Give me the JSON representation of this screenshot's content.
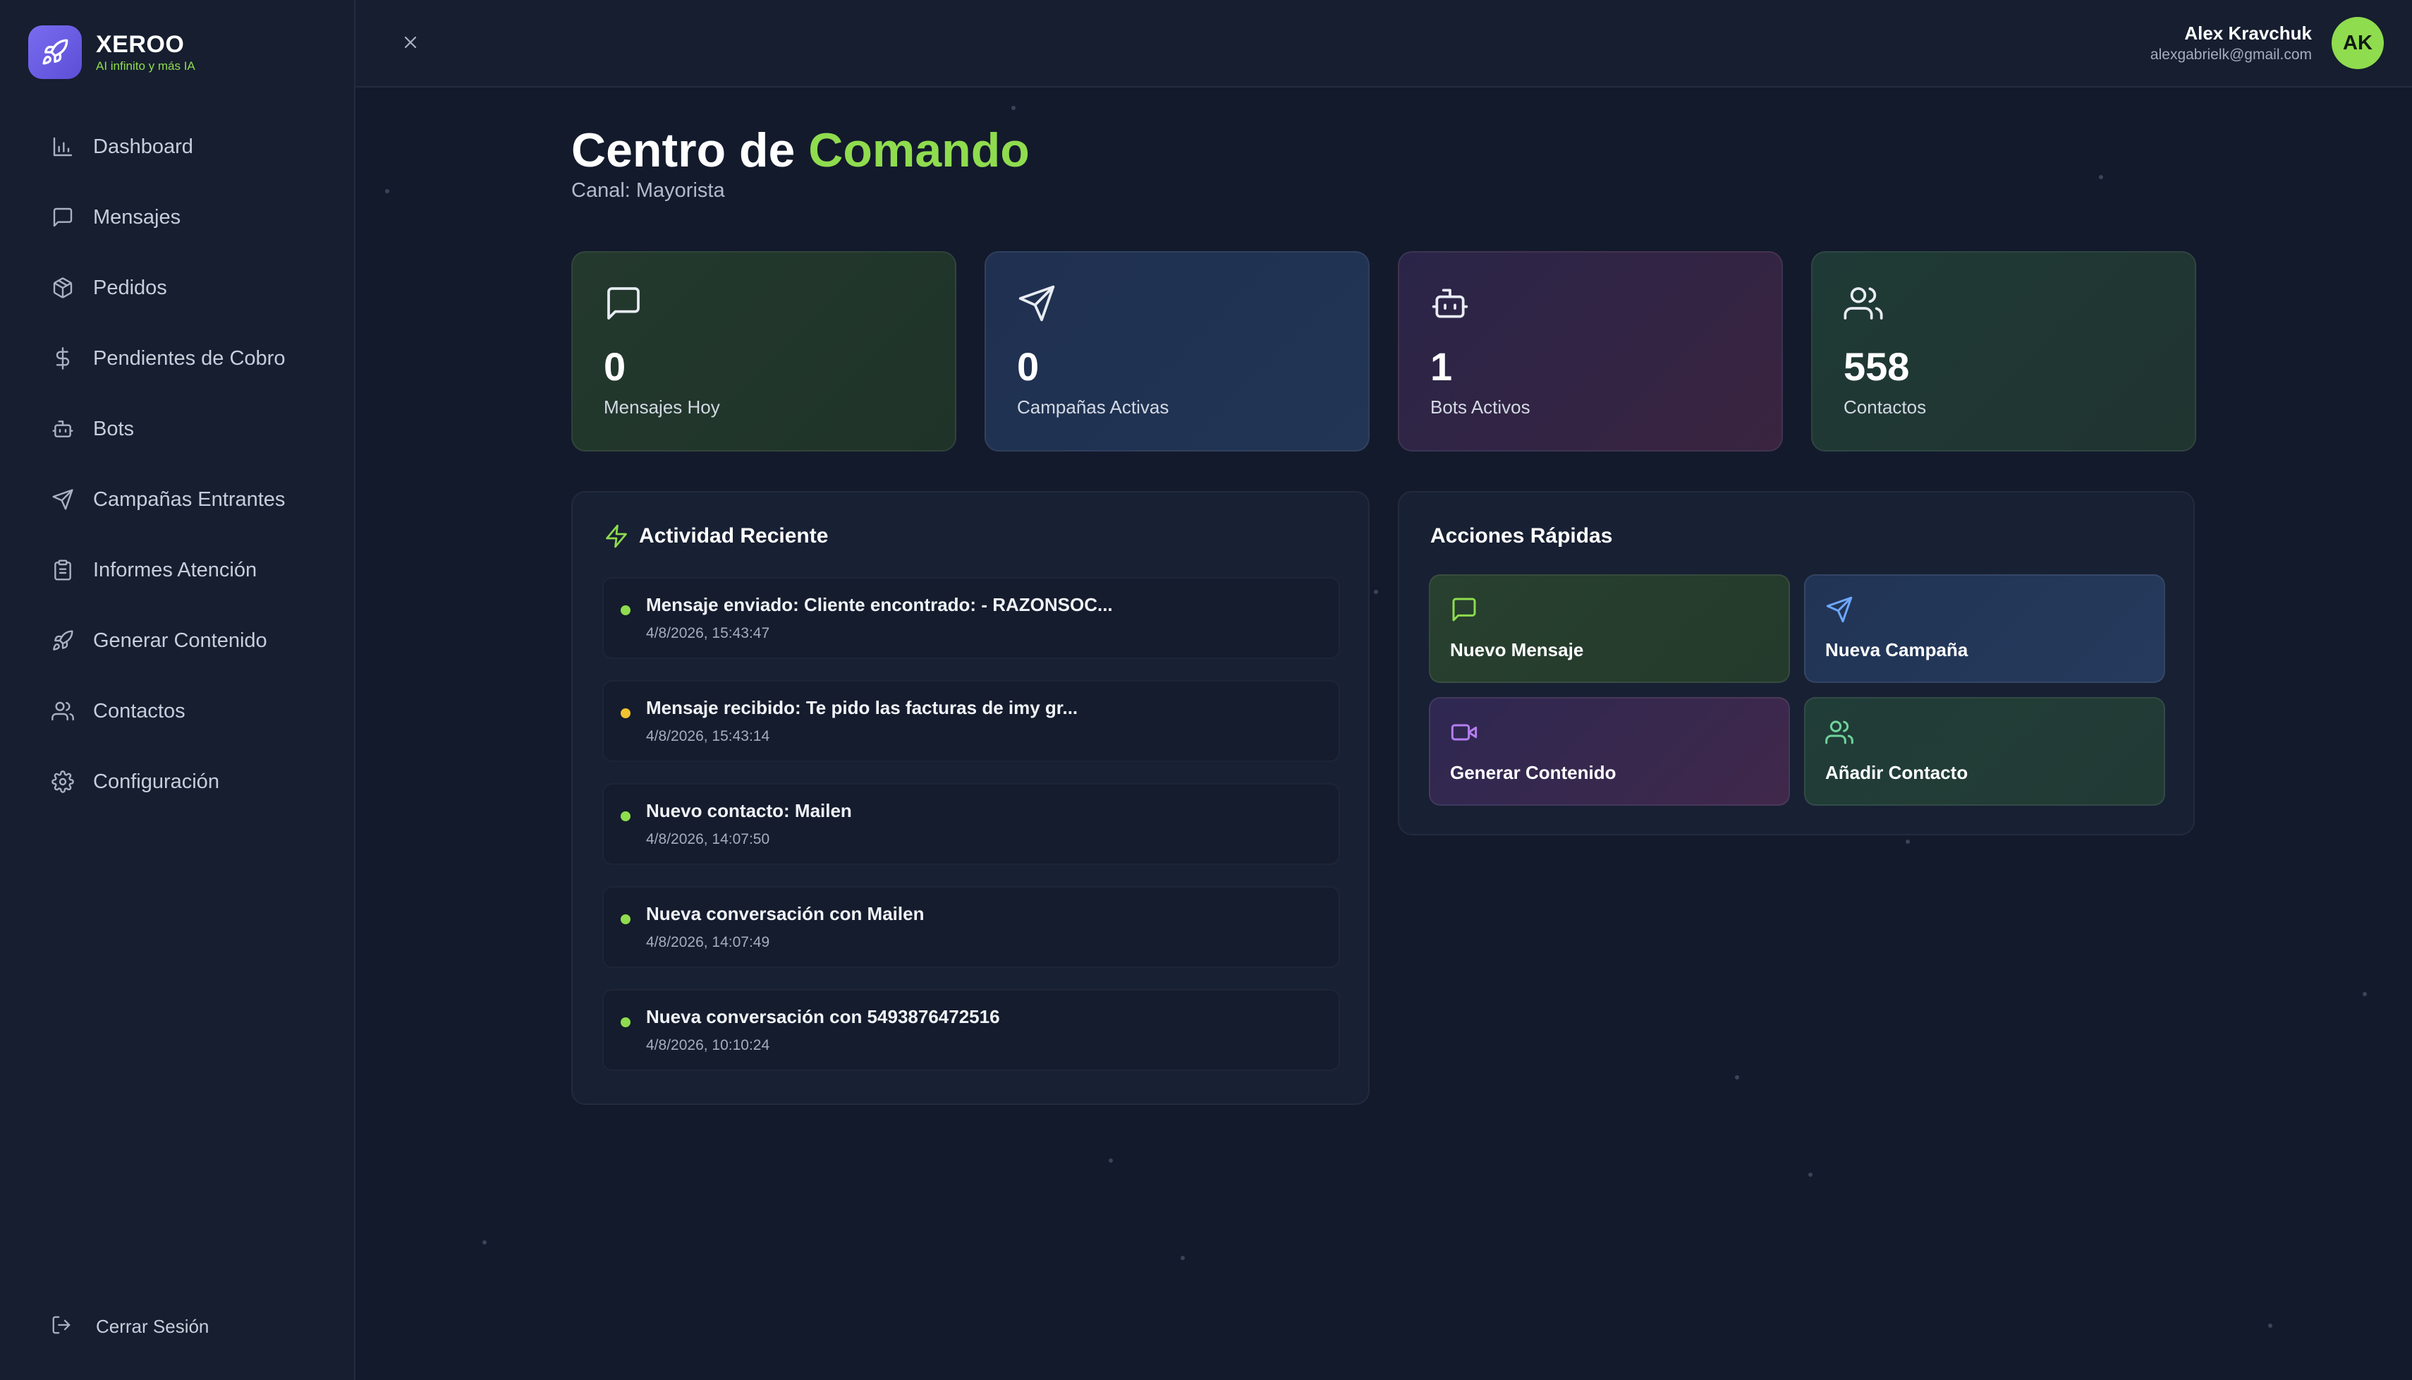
{
  "brand": {
    "name": "XEROO",
    "tagline": "AI infinito y más IA"
  },
  "sidebar": {
    "items": [
      {
        "label": "Dashboard",
        "icon": "bar-chart-icon"
      },
      {
        "label": "Mensajes",
        "icon": "message-square-icon"
      },
      {
        "label": "Pedidos",
        "icon": "package-icon"
      },
      {
        "label": "Pendientes de Cobro",
        "icon": "dollar-sign-icon"
      },
      {
        "label": "Bots",
        "icon": "bot-icon"
      },
      {
        "label": "Campañas Entrantes",
        "icon": "send-icon"
      },
      {
        "label": "Informes Atención",
        "icon": "clipboard-icon"
      },
      {
        "label": "Generar Contenido",
        "icon": "rocket-icon"
      },
      {
        "label": "Contactos",
        "icon": "users-icon"
      },
      {
        "label": "Configuración",
        "icon": "gear-icon"
      }
    ],
    "logout_label": "Cerrar Sesión"
  },
  "user": {
    "name": "Alex Kravchuk",
    "email": "alexgabrielk@gmail.com",
    "initials": "AK"
  },
  "page": {
    "title_main": "Centro de ",
    "title_accent": "Comando",
    "subtitle": "Canal: Mayorista"
  },
  "stats": [
    {
      "value": "0",
      "label": "Mensajes Hoy",
      "icon": "message-square-icon"
    },
    {
      "value": "0",
      "label": "Campañas Activas",
      "icon": "send-icon"
    },
    {
      "value": "1",
      "label": "Bots Activos",
      "icon": "bot-icon"
    },
    {
      "value": "558",
      "label": "Contactos",
      "icon": "users-icon"
    }
  ],
  "activity": {
    "title": "Actividad Reciente",
    "items": [
      {
        "text": "Mensaje enviado: Cliente encontrado: - RAZONSOC...",
        "time": "4/8/2026, 15:43:47",
        "dot_color": "#8fdc4e"
      },
      {
        "text": "Mensaje recibido: Te pido las facturas de imy gr...",
        "time": "4/8/2026, 15:43:14",
        "dot_color": "#f2c230"
      },
      {
        "text": "Nuevo contacto: Mailen",
        "time": "4/8/2026, 14:07:50",
        "dot_color": "#8fdc4e"
      },
      {
        "text": "Nueva conversación con Mailen",
        "time": "4/8/2026, 14:07:49",
        "dot_color": "#8fdc4e"
      },
      {
        "text": "Nueva conversación con 5493876472516",
        "time": "4/8/2026, 10:10:24",
        "dot_color": "#8fdc4e"
      }
    ]
  },
  "quick_actions": {
    "title": "Acciones Rápidas",
    "items": [
      {
        "label": "Nuevo Mensaje",
        "icon": "message-square-icon"
      },
      {
        "label": "Nueva Campaña",
        "icon": "send-icon"
      },
      {
        "label": "Generar Contenido",
        "icon": "video-icon"
      },
      {
        "label": "Añadir Contacto",
        "icon": "users-icon"
      }
    ]
  },
  "colors": {
    "accent": "#8fdc4e",
    "background": "#131a2c",
    "sidebar": "#161e2f",
    "brand": "#6b5ee6"
  }
}
